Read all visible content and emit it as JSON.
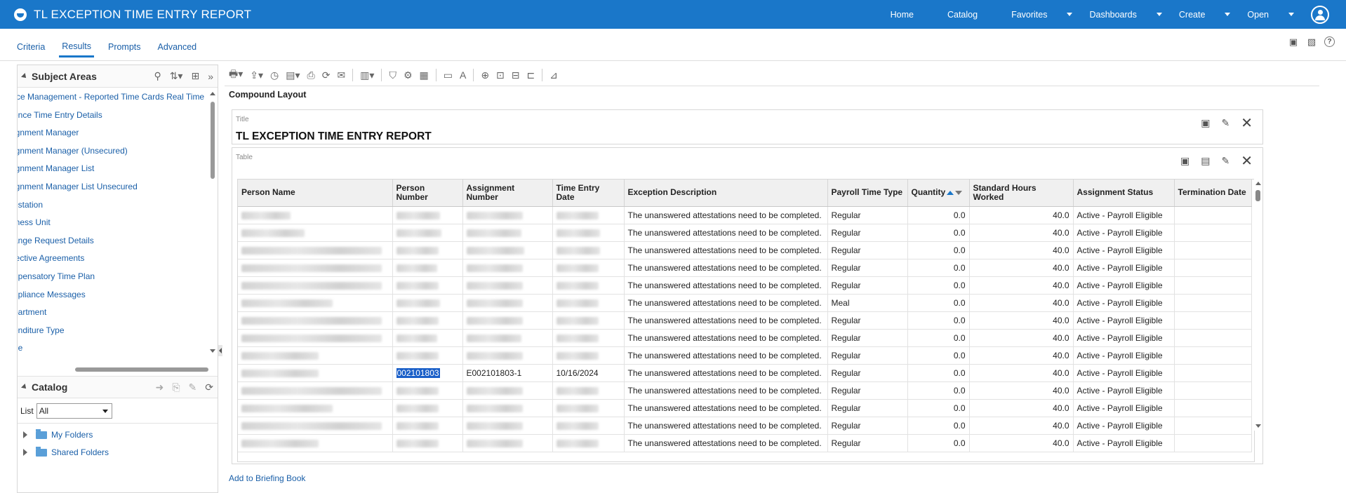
{
  "header": {
    "app_title": "TL EXCEPTION TIME ENTRY REPORT",
    "nav": [
      "Home",
      "Catalog",
      "Favorites",
      "Dashboards",
      "Create",
      "Open"
    ],
    "nav_dropdown": [
      false,
      false,
      true,
      true,
      true,
      true
    ]
  },
  "tabs": [
    "Criteria",
    "Results",
    "Prompts",
    "Advanced"
  ],
  "active_tab": "Results",
  "subject_areas": {
    "title": "Subject Areas",
    "items": [
      "rce Management - Reported Time Cards Real Time",
      "ence Time Entry Details",
      "ignment Manager",
      "ignment Manager (Unsecured)",
      "ignment Manager List",
      "ignment Manager List Unsecured",
      "estation",
      "iness Unit",
      "ange Request Details",
      "lective Agreements",
      "npensatory Time Plan",
      "npliance Messages",
      "partment",
      "enditure Type",
      "de"
    ]
  },
  "catalog": {
    "title": "Catalog",
    "list_label": "List",
    "list_value": "All",
    "folders": [
      "My Folders",
      "Shared Folders"
    ]
  },
  "main": {
    "compound_label": "Compound Layout",
    "title_view": {
      "label": "Title",
      "report_title": "TL EXCEPTION TIME ENTRY REPORT"
    },
    "table_view": {
      "label": "Table",
      "columns": [
        "Person Name",
        "Person Number",
        "Assignment Number",
        "Time Entry Date",
        "Exception Description",
        "Payroll Time Type",
        "Quantity",
        "Standard Hours Worked",
        "Assignment Status",
        "Termination Date"
      ],
      "rows": [
        {
          "payroll": "Regular",
          "qty": "0.0",
          "hours": "40.0",
          "status": "Active - Payroll Eligible"
        },
        {
          "payroll": "Regular",
          "qty": "0.0",
          "hours": "40.0",
          "status": "Active - Payroll Eligible"
        },
        {
          "payroll": "Regular",
          "qty": "0.0",
          "hours": "40.0",
          "status": "Active - Payroll Eligible"
        },
        {
          "payroll": "Regular",
          "qty": "0.0",
          "hours": "40.0",
          "status": "Active - Payroll Eligible"
        },
        {
          "payroll": "Regular",
          "qty": "0.0",
          "hours": "40.0",
          "status": "Active - Payroll Eligible"
        },
        {
          "payroll": "Meal",
          "qty": "0.0",
          "hours": "40.0",
          "status": "Active - Payroll Eligible"
        },
        {
          "payroll": "Regular",
          "qty": "0.0",
          "hours": "40.0",
          "status": "Active - Payroll Eligible"
        },
        {
          "payroll": "Regular",
          "qty": "0.0",
          "hours": "40.0",
          "status": "Active - Payroll Eligible"
        },
        {
          "payroll": "Regular",
          "qty": "0.0",
          "hours": "40.0",
          "status": "Active - Payroll Eligible"
        },
        {
          "payroll": "Regular",
          "qty": "0.0",
          "hours": "40.0",
          "status": "Active - Payroll Eligible"
        },
        {
          "payroll": "Regular",
          "qty": "0.0",
          "hours": "40.0",
          "status": "Active - Payroll Eligible"
        },
        {
          "payroll": "Regular",
          "qty": "0.0",
          "hours": "40.0",
          "status": "Active - Payroll Eligible"
        },
        {
          "payroll": "Regular",
          "qty": "0.0",
          "hours": "40.0",
          "status": "Active - Payroll Eligible"
        },
        {
          "payroll": "Regular",
          "qty": "0.0",
          "hours": "40.0",
          "status": "Active - Payroll Eligible"
        }
      ],
      "exception_text": "The unanswered attestations need to be completed.",
      "visible_row": {
        "index": 9,
        "person_number": "002101803",
        "assignment_number": "E002101803-1",
        "time_entry_date": "10/16/2024"
      }
    }
  },
  "footer_link": "Add to Briefing Book"
}
